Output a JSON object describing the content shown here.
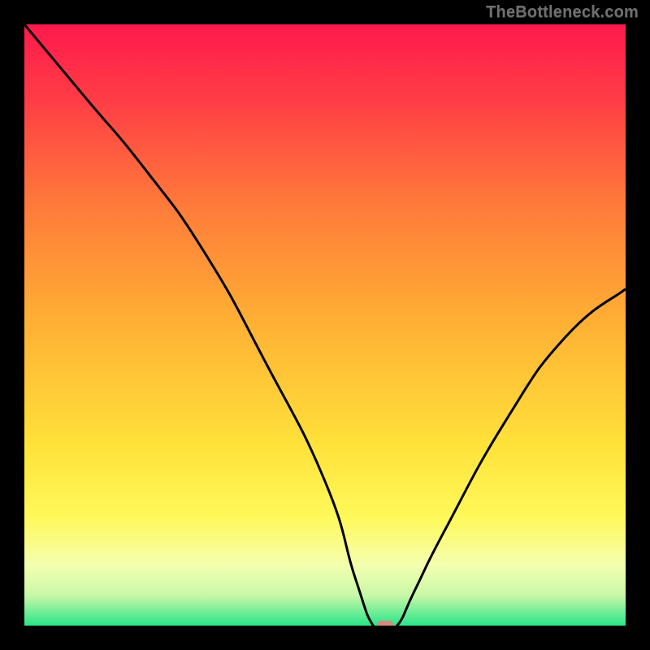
{
  "watermark": "TheBottleneck.com",
  "chart_data": {
    "type": "line",
    "title": "",
    "xlabel": "",
    "ylabel": "",
    "xlim": [
      0,
      100
    ],
    "ylim": [
      0,
      100
    ],
    "grid": false,
    "legend": null,
    "series": [
      {
        "name": "bottleneck-curve",
        "x": [
          0,
          10,
          20,
          30,
          40,
          50,
          55,
          58,
          60,
          62,
          65,
          70,
          80,
          90,
          100
        ],
        "y": [
          100,
          88,
          76,
          62,
          44,
          24,
          8,
          0,
          0,
          0,
          6,
          16,
          34,
          48,
          56
        ],
        "color": "#000000",
        "line_width": 2
      }
    ],
    "marker": {
      "name": "optimal-point",
      "x": 60,
      "y": 0,
      "color": "#d9887f",
      "shape": "rounded-rect"
    },
    "background": {
      "type": "vertical-gradient",
      "stops": [
        {
          "pos": 0.0,
          "color": "#ff1a4d"
        },
        {
          "pos": 0.12,
          "color": "#ff3b46"
        },
        {
          "pos": 0.3,
          "color": "#ff7a3a"
        },
        {
          "pos": 0.5,
          "color": "#ffb134"
        },
        {
          "pos": 0.7,
          "color": "#ffe23a"
        },
        {
          "pos": 0.82,
          "color": "#fff95a"
        },
        {
          "pos": 0.9,
          "color": "#f4ffb0"
        },
        {
          "pos": 0.95,
          "color": "#c8f7a8"
        },
        {
          "pos": 1.0,
          "color": "#29e58a"
        }
      ]
    }
  }
}
